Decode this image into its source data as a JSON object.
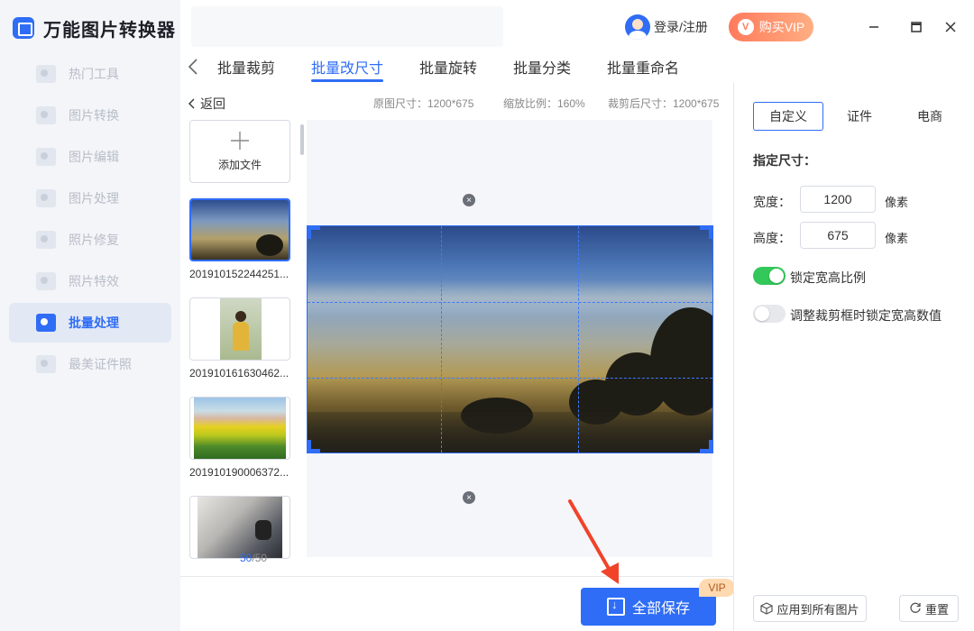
{
  "app": {
    "title": "万能图片转换器"
  },
  "sidebar": {
    "items": [
      {
        "label": "热门工具",
        "icon": "hot-tools-icon"
      },
      {
        "label": "图片转换",
        "icon": "image-convert-icon"
      },
      {
        "label": "图片编辑",
        "icon": "image-edit-icon"
      },
      {
        "label": "图片处理",
        "icon": "image-process-icon"
      },
      {
        "label": "照片修复",
        "icon": "photo-repair-icon"
      },
      {
        "label": "照片特效",
        "icon": "photo-effects-icon"
      },
      {
        "label": "批量处理",
        "icon": "batch-process-icon",
        "active": true
      },
      {
        "label": "最美证件照",
        "icon": "id-photo-icon"
      }
    ]
  },
  "header": {
    "user_label": "登录/注册",
    "vip_label": "购买VIP",
    "vip_icon_text": "V"
  },
  "tabs": [
    {
      "label": "批量裁剪"
    },
    {
      "label": "批量改尺寸",
      "active": true
    },
    {
      "label": "批量旋转"
    },
    {
      "label": "批量分类"
    },
    {
      "label": "批量重命名"
    }
  ],
  "toolbar": {
    "back_label": "返回",
    "original_size": "原图尺寸：1200*675",
    "zoom": "缩放比例：160%",
    "cropped_size": "裁剪后尺寸：1200*675"
  },
  "file_list": {
    "add_label": "添加文件",
    "files": [
      {
        "name": "201910152244251..."
      },
      {
        "name": "201910161630462..."
      },
      {
        "name": "201910190006372..."
      },
      {
        "name": ""
      }
    ],
    "counter_current": "50",
    "counter_total": "/50"
  },
  "actions": {
    "save_all_label": "全部保存",
    "vip_tag": "VIP"
  },
  "right_panel": {
    "tabs": [
      {
        "label": "自定义",
        "active": true
      },
      {
        "label": "证件"
      },
      {
        "label": "电商"
      }
    ],
    "section_title": "指定尺寸：",
    "width_label": "宽度：",
    "width_value": "1200",
    "height_label": "高度：",
    "height_value": "675",
    "unit": "像素",
    "lock_ratio_label": "锁定宽高比例",
    "lock_ratio_on": true,
    "lock_crop_label": "调整裁剪框时锁定宽高数值",
    "lock_crop_on": false,
    "apply_all_label": "应用到所有图片",
    "reset_label": "重置"
  },
  "colors": {
    "accent": "#2f6df6",
    "toggle_on": "#34c759",
    "vip": "#ff7a5c",
    "arrow": "#f0432a"
  }
}
